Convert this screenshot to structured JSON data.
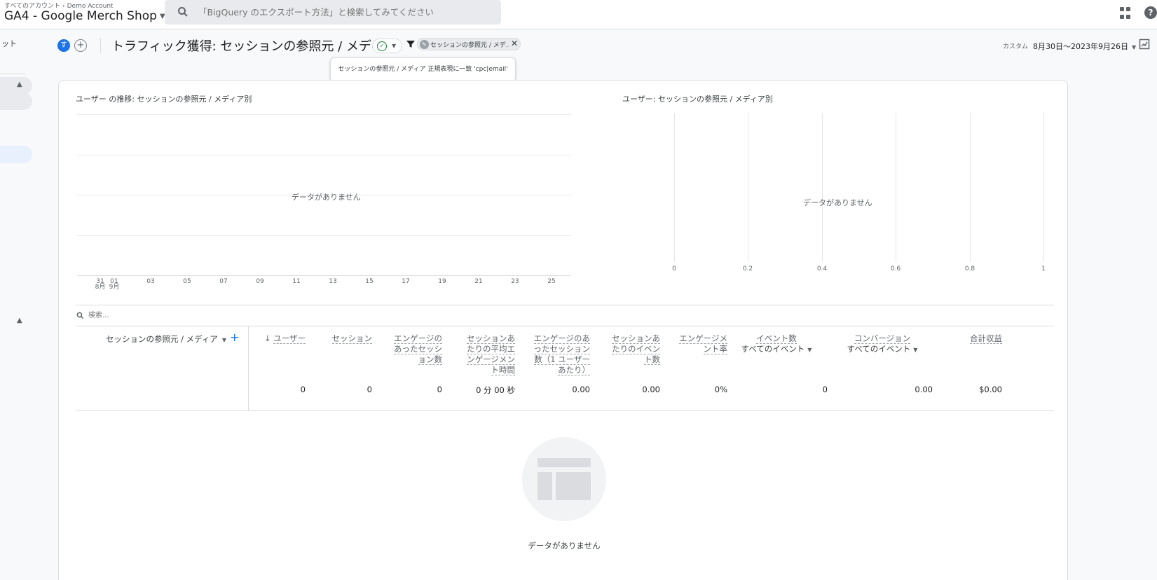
{
  "header": {
    "breadcrumb_root": "すべてのアカウント",
    "breadcrumb_account": "Demo Account",
    "property_name": "GA4 - Google Merch Shop",
    "search_placeholder": "「BigQuery のエクスポート方法」と検索してみてください"
  },
  "sidebar": {
    "fragment": "ット"
  },
  "report": {
    "avatar_letter": "す",
    "title": "トラフィック獲得: セッションの参照元 / メディア",
    "filter_chip": "セッションの参照元 / メデ…",
    "filter_tooltip": "セッションの参照元 / メディア 正規表現に一致 'cpc|email'",
    "date_label": "カスタム",
    "date_range": "8月30日～2023年9月26日"
  },
  "line_chart": {
    "title": "ユーザー の推移: セッションの参照元 / メディア別",
    "empty_text": "データがありません",
    "x_ticks": [
      "31",
      "01",
      "03",
      "05",
      "07",
      "09",
      "11",
      "13",
      "15",
      "17",
      "19",
      "21",
      "23",
      "25"
    ],
    "month_labels": [
      "8月",
      "9月"
    ]
  },
  "bar_chart": {
    "title": "ユーザー: セッションの参照元 / メディア別",
    "empty_text": "データがありません",
    "x_ticks": [
      "0",
      "0.2",
      "0.4",
      "0.6",
      "0.8",
      "1"
    ]
  },
  "table": {
    "search_placeholder": "検索...",
    "dimension_header": "セッションの参照元 / メディア",
    "metrics": [
      {
        "name": "sort-arrow-ユーザー",
        "l1": "ユーザー"
      },
      {
        "l1": "セッション"
      },
      {
        "l1": "エンゲージの",
        "l2": "あったセッシ",
        "l3": "ョン数"
      },
      {
        "l1": "セッションあ",
        "l2": "たりの平均エ",
        "l3": "ンゲージメン",
        "l4": "ト時間"
      },
      {
        "l1": "エンゲージのあ",
        "l2": "ったセッション",
        "l3": "数（1 ユーザー",
        "l4": "あたり）"
      },
      {
        "l1": "セッションあ",
        "l2": "たりのイベン",
        "l3": "ト数"
      },
      {
        "l1": "エンゲージメ",
        "l2": "ント率"
      },
      {
        "l1": "イベント数",
        "sub": "すべてのイベント"
      },
      {
        "l1": "コンバージョン",
        "sub": "すべてのイベント"
      },
      {
        "l1": "合計収益"
      }
    ],
    "totals": [
      "0",
      "0",
      "0",
      "0 分 00 秒",
      "0.00",
      "0.00",
      "0%",
      "0",
      "0.00",
      "$0.00"
    ],
    "empty_text": "データがありません"
  },
  "colors": {
    "accent": "#1a73e8",
    "success": "#188038",
    "border": "#dadce0",
    "background": "#f8f9fa"
  }
}
